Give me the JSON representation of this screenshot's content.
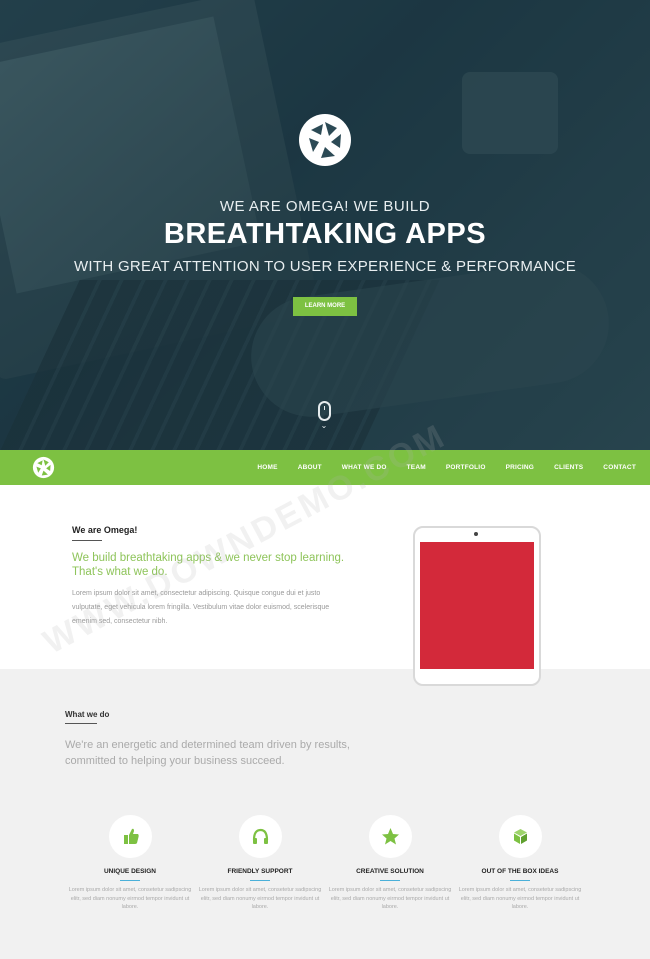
{
  "hero": {
    "line1": "WE ARE OMEGA! WE BUILD",
    "title": "BREATHTAKING APPS",
    "line3": "WITH GREAT ATTENTION TO USER EXPERIENCE & PERFORMANCE",
    "button": "LEARN MORE",
    "logo_icon": "aperture-icon",
    "scroll_icon": "mouse-icon"
  },
  "nav": {
    "logo_icon": "aperture-icon",
    "items": [
      "HOME",
      "ABOUT",
      "WHAT WE DO",
      "TEAM",
      "PORTFOLIO",
      "PRICING",
      "CLIENTS",
      "CONTACT"
    ]
  },
  "about": {
    "label": "We are Omega!",
    "lead": "We build breathtaking apps & we never stop learning. That's what we do.",
    "body": "Lorem ipsum dolor sit amet, consectetur adipiscing. Quisque congue dui et justo vulputate, eget vehicula lorem fringilla. Vestibulum vitae dolor euismod, scelerisque emenim sed, consectetur nibh."
  },
  "what_we_do": {
    "label": "What we do",
    "lead": "We're an energetic and determined team driven by results, committed to helping your business succeed.",
    "features": [
      {
        "icon": "thumbs-up-icon",
        "title": "UNIQUE DESIGN",
        "text": "Lorem ipsum dolor sit amet, consetetur sadipscing elitr, sed diam nonumy eirmod tempor invidunt ut labore."
      },
      {
        "icon": "headphones-icon",
        "title": "FRIENDLY SUPPORT",
        "text": "Lorem ipsum dolor sit amet, consetetur sadipscing elitr, sed diam nonumy eirmod tempor invidunt ut labore."
      },
      {
        "icon": "star-icon",
        "title": "CREATIVE SOLUTION",
        "text": "Lorem ipsum dolor sit amet, consetetur sadipscing elitr, sed diam nonumy eirmod tempor invidunt ut labore."
      },
      {
        "icon": "cube-icon",
        "title": "OUT OF THE BOX IDEAS",
        "text": "Lorem ipsum dolor sit amet, consetetur sadipscing elitr, sed diam nonumy eirmod tempor invidunt ut labore."
      }
    ]
  },
  "watermark": "WWW.DOWNDEMO.COM",
  "colors": {
    "accent": "#7dc142",
    "hero_overlay": "#18343e",
    "ipad_screen": "#d3293a",
    "feature_rule": "#4ab0d9"
  }
}
